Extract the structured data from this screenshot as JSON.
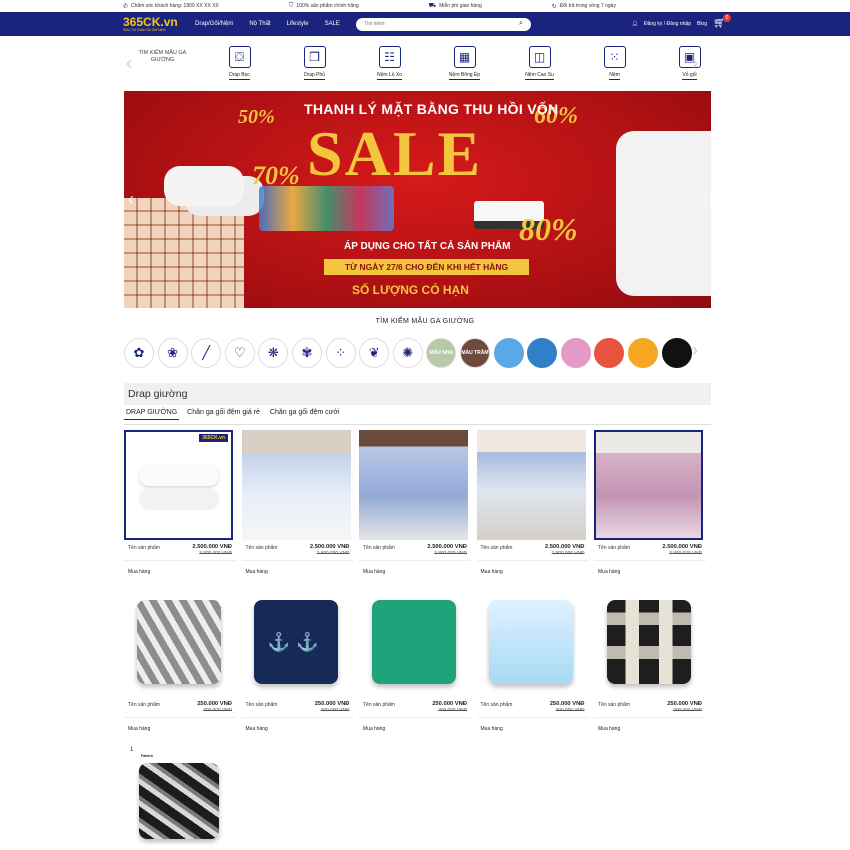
{
  "topbar": {
    "items": [
      {
        "icon": "phone-icon",
        "text": "Chăm sóc khách hàng: 1900 XX XX XX"
      },
      {
        "icon": "shield-check-icon",
        "text": "100% sản phẩm chính hãng"
      },
      {
        "icon": "truck-icon",
        "text": "Miễn phí giao hàng"
      },
      {
        "icon": "refresh-icon",
        "text": "Đổi trả trong vòng 7 ngày"
      }
    ]
  },
  "header": {
    "logo": "365CK.vn",
    "logo_tagline": "Siêu Thị Chăn Ga Gối Nệm",
    "nav": [
      "Drap/Gối/Nệm",
      "Nộ Thất",
      "Lifestyle",
      "SALE"
    ],
    "search_placeholder": "Tìm kiếm",
    "account": "Đăng ký / Đăng nhập",
    "blog": "Blog",
    "cart_count": "0"
  },
  "categories": {
    "first": "TÌM KIẾM MẪU GA GIƯỜNG",
    "items": [
      {
        "label": "Drap Bọc",
        "icon": "bed-icon"
      },
      {
        "label": "Drap Phủ",
        "icon": "sheet-icon"
      },
      {
        "label": "Nệm Lò Xo",
        "icon": "spring-mattress-icon"
      },
      {
        "label": "Nệm Bông Ép",
        "icon": "foam-mattress-icon"
      },
      {
        "label": "Nệm Cao Su",
        "icon": "latex-mattress-icon"
      },
      {
        "label": "Nệm",
        "icon": "mattress-icon"
      },
      {
        "label": "Vỏ gối",
        "icon": "pillowcase-icon"
      }
    ]
  },
  "banner": {
    "headline": "THANH LÝ MẶT BẰNG THU HỒI VỐN",
    "sale": "SALE",
    "pct50": "50%",
    "pct60": "60%",
    "pct70": "70%",
    "pct80": "80%",
    "apply": "ÁP DỤNG CHO TẤT CẢ SẢN PHẨM",
    "date": "TỪ NGÀY 27/6 CHO ĐẾN KHI HẾT HÀNG",
    "limited": "SỐ LƯỢNG CÓ HẠN"
  },
  "color_search": {
    "title": "TÌM KIẾM MẪU GA GIƯỜNG",
    "swatches": [
      {
        "type": "pattern",
        "glyph": "✿"
      },
      {
        "type": "pattern",
        "glyph": "❀"
      },
      {
        "type": "pattern",
        "glyph": "╱"
      },
      {
        "type": "pattern",
        "glyph": "♡"
      },
      {
        "type": "pattern",
        "glyph": "❋"
      },
      {
        "type": "pattern",
        "glyph": "✾"
      },
      {
        "type": "pattern",
        "glyph": "⁘"
      },
      {
        "type": "pattern",
        "glyph": "❦"
      },
      {
        "type": "pattern",
        "glyph": "✺"
      },
      {
        "type": "text",
        "label": "MÀU NHẠ",
        "color": "#b7c9a6"
      },
      {
        "type": "text",
        "label": "MÀU TRẦM",
        "color": "#6d4a3a"
      },
      {
        "type": "color",
        "color": "#5aa9e6"
      },
      {
        "type": "color",
        "color": "#2f7fc9"
      },
      {
        "type": "color",
        "color": "#e59ac6"
      },
      {
        "type": "color",
        "color": "#e9533d"
      },
      {
        "type": "color",
        "color": "#f5a623"
      },
      {
        "type": "color",
        "color": "#111111"
      }
    ]
  },
  "section": {
    "title": "Drap giường",
    "tabs": [
      "DRAP GIƯỜNG",
      "Chăn ga gối đệm giá rẻ",
      "Chăn ga gối đệm cưới"
    ]
  },
  "products_row1": [
    {
      "name": "Tên sản phẩm",
      "price": "2.500.000 VNĐ",
      "old": "2.800.000 VNĐ",
      "buy": "Mua hàng",
      "visual": "pillows"
    },
    {
      "name": "Tên sản phẩm",
      "price": "2.500.000 VNĐ",
      "old": "2.800.000 VNĐ",
      "buy": "Mua hàng",
      "visual": "bs1"
    },
    {
      "name": "Tên sản phẩm",
      "price": "2.500.000 VNĐ",
      "old": "2.800.000 VNĐ",
      "buy": "Mua hàng",
      "visual": "bs2"
    },
    {
      "name": "Tên sản phẩm",
      "price": "2.500.000 VNĐ",
      "old": "2.800.000 VNĐ",
      "buy": "Mua hàng",
      "visual": "bs3"
    },
    {
      "name": "Tên sản phẩm",
      "price": "2.500.000 VNĐ",
      "old": "2.800.000 VNĐ",
      "buy": "Mua hàng",
      "visual": "bs4"
    }
  ],
  "products_row2": [
    {
      "name": "Tên sản phẩm",
      "price": "250.000 VNĐ",
      "old": "300.000 VNĐ",
      "buy": "Mua hàng",
      "visual": "cz"
    },
    {
      "name": "Tên sản phẩm",
      "price": "250.000 VNĐ",
      "old": "300.000 VNĐ",
      "buy": "Mua hàng",
      "visual": "ca"
    },
    {
      "name": "Tên sản phẩm",
      "price": "250.000 VNĐ",
      "old": "300.000 VNĐ",
      "buy": "Mua hàng",
      "visual": "cg"
    },
    {
      "name": "Tên sản phẩm",
      "price": "250.000 VNĐ",
      "old": "300.000 VNĐ",
      "buy": "Mua hàng",
      "visual": "cx"
    },
    {
      "name": "Tên sản phẩm",
      "price": "250.000 VNĐ",
      "old": "300.000 VNĐ",
      "buy": "Mua hàng",
      "visual": "cb"
    }
  ],
  "pager": {
    "page": "1",
    "label": "Pattern"
  },
  "colors": {
    "navy": "#1a237e",
    "gold": "#f5c518",
    "sale_red": "#c41416"
  }
}
